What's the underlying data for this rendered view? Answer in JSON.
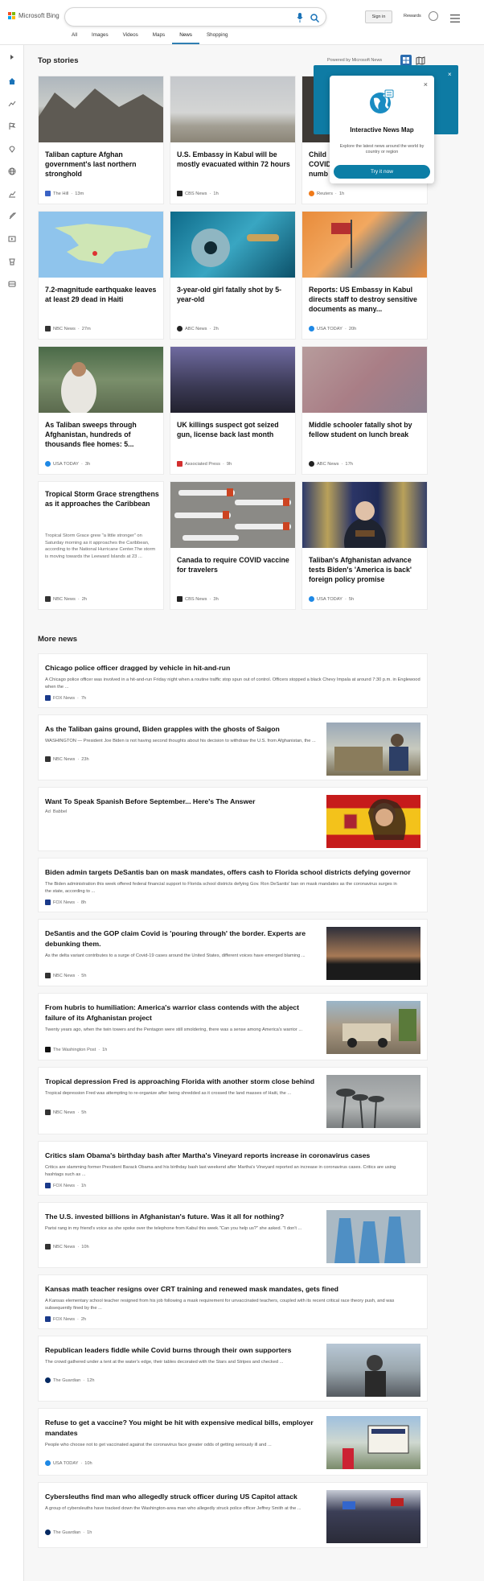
{
  "header": {
    "brand": "Microsoft Bing",
    "search_value": "",
    "sign_in": "Sign in",
    "rewards": "Rewards",
    "tabs": [
      "All",
      "Images",
      "Videos",
      "Maps",
      "News",
      "Shopping"
    ],
    "active_tab": "News"
  },
  "top_stories": {
    "title": "Top stories",
    "powered_by": "Powered by Microsoft News",
    "cards": [
      {
        "title": "Taliban capture Afghan government's last northern stronghold",
        "source": "The Hill",
        "time": "13m",
        "logo_color": "#3a62c4"
      },
      {
        "title": "U.S. Embassy in Kabul will be mostly evacuated within 72 hours",
        "source": "CBS News",
        "time": "1h",
        "logo_color": "#222222"
      },
      {
        "title": "Child COVID numb",
        "source": "Reuters",
        "time": "1h",
        "logo_color": "#f07a1a"
      },
      {
        "title": "7.2-magnitude earthquake leaves at least 29 dead in Haiti",
        "source": "NBC News",
        "time": "27m",
        "logo_color": "#333333"
      },
      {
        "title": "3-year-old girl fatally shot by 5-year-old",
        "source": "ABC News",
        "time": "2h",
        "logo_color": "#222222"
      },
      {
        "title": "Reports: US Embassy in Kabul directs staff to destroy sensitive documents as many...",
        "source": "USA TODAY",
        "time": "20h",
        "logo_color": "#1e88e5"
      },
      {
        "title": "As Taliban sweeps through Afghanistan, hundreds of thousands flee homes: 5...",
        "source": "USA TODAY",
        "time": "3h",
        "logo_color": "#1e88e5"
      },
      {
        "title": "UK killings suspect got seized gun, license back last month",
        "source": "Associated Press",
        "time": "9h",
        "logo_color": "#d32f2f"
      },
      {
        "title": "Middle schooler fatally shot by fellow student on lunch break",
        "source": "ABC News",
        "time": "17h",
        "logo_color": "#222222"
      },
      {
        "title": "Tropical Storm Grace strengthens as it approaches the Caribbean",
        "summary": "Tropical Storm Grace grew \"a little stronger\" on Saturday morning as it approaches the Caribbean, according to the National Hurricane Center.The storm is moving towards the Leeward Islands at 23 ...",
        "source": "NBC News",
        "time": "2h",
        "logo_color": "#333333"
      },
      {
        "title": "Canada to require COVID vaccine for travelers",
        "source": "CBS News",
        "time": "3h",
        "logo_color": "#222222"
      },
      {
        "title": "Taliban's Afghanistan advance tests Biden's 'America is back' foreign policy promise",
        "source": "USA TODAY",
        "time": "5h",
        "logo_color": "#1e88e5"
      }
    ]
  },
  "popup": {
    "title": "Interactive News Map",
    "description": "Explore the latest news around the world by country or region",
    "button": "Try it now",
    "close": "×"
  },
  "more_news": {
    "title": "More news",
    "items": [
      {
        "title": "Chicago police officer dragged by vehicle in hit-and-run",
        "desc": "A Chicago police officer was involved in a hit-and-run Friday night when a routine traffic stop spun out of control.  Officers stopped a black Chevy Impala at around 7:30 p.m. in Englewood when the ...",
        "source": "FOX News",
        "time": "7h",
        "logo_color": "#1a3a8a"
      },
      {
        "title": "As the Taliban gains ground, Biden grapples with the ghosts of Saigon",
        "desc": "WASHINGTON — President Joe Biden is not having second thoughts about his decision to withdraw the U.S. from Afghanistan, the ...",
        "source": "NBC News",
        "time": "23h",
        "logo_color": "#333333"
      },
      {
        "title": "Want To Speak Spanish Before September... Here's The Answer",
        "desc": "",
        "ad": "Ad",
        "source": "Babbel",
        "time": "",
        "logo_color": ""
      },
      {
        "title": "Biden admin targets DeSantis ban on mask mandates, offers cash to Florida school districts defying governor",
        "desc": "The Biden administration this week offered federal financial support to Florida school districts defying Gov. Ron DeSantis' ban on mask mandates as the coronavirus surges in the state, according to ...",
        "source": "FOX News",
        "time": "8h",
        "logo_color": "#1a3a8a"
      },
      {
        "title": "DeSantis and the GOP claim Covid is 'pouring through' the border. Experts are debunking them.",
        "desc": "As the delta variant contributes to a surge of Covid-19 cases around the United States, different voices have emerged blaming ...",
        "source": "NBC News",
        "time": "5h",
        "logo_color": "#333333"
      },
      {
        "title": "From hubris to humiliation: America's warrior class contends with the abject failure of its Afghanistan project",
        "desc": "Twenty years ago, when the twin towers and the Pentagon were still smoldering, there was a sense among America's warrior ...",
        "source": "The Washington Post",
        "time": "1h",
        "logo_color": "#111111"
      },
      {
        "title": "Tropical depression Fred is approaching Florida with another storm close behind",
        "desc": "Tropical depression Fred was attempting to re-organize after being shredded as it crossed the land masses of Haiti, the ...",
        "source": "NBC News",
        "time": "5h",
        "logo_color": "#333333"
      },
      {
        "title": "Critics slam Obama's birthday bash after Martha's Vineyard reports increase in coronavirus cases",
        "desc": "Critics are slamming former President Barack Obama and his birthday bash last weekend after Martha's Vineyard reported an increase in coronavirus cases. Critics are using hashtags such as ...",
        "source": "FOX News",
        "time": "1h",
        "logo_color": "#1a3a8a"
      },
      {
        "title": "The U.S. invested billions in Afghanistan's future. Was it all for nothing?",
        "desc": "Parisi rang in my friend's voice as she spoke over the telephone from Kabul this week.\"Can you help us?\" she asked. \"I don't ...",
        "source": "NBC News",
        "time": "10h",
        "logo_color": "#333333"
      },
      {
        "title": "Kansas math teacher resigns over CRT training and renewed mask mandates, gets fined",
        "desc": "A Kansas elementary school teacher resigned from his job following a mask requirement for unvaccinated teachers, coupled with its recent critical race theory push, and was subsequently fined by the ...",
        "source": "FOX News",
        "time": "2h",
        "logo_color": "#1a3a8a"
      },
      {
        "title": "Republican leaders fiddle while Covid burns through their own supporters",
        "desc": "The crowd gathered under a tent at the water's edge, their tables decorated with the Stars and Stripes and checked ...",
        "source": "The Guardian",
        "time": "12h",
        "logo_color": "#052962"
      },
      {
        "title": "Refuse to get a vaccine? You might be hit with expensive medical bills, employer mandates",
        "desc": "People who choose not to get vaccinated against the coronavirus face greater odds of getting seriously ill and ...",
        "source": "USA TODAY",
        "time": "10h",
        "logo_color": "#1e88e5"
      },
      {
        "title": "Cybersleuths find man who allegedly struck officer during US Capitol attack",
        "desc": "A group of cybersleuths have tracked down the Washington-area man who allegedly struck police officer Jeffrey Smith at the ...",
        "source": "The Guardian",
        "time": "1h",
        "logo_color": "#052962"
      }
    ]
  },
  "colors": {
    "accent": "#0c7ea6",
    "brand_blue": "#2f7fb3"
  }
}
